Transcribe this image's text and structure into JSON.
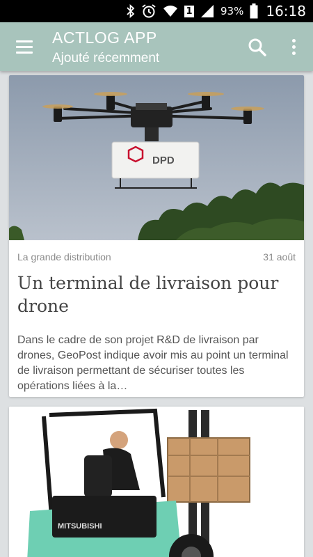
{
  "status_bar": {
    "battery": "93%",
    "sim_slot": "1",
    "time": "16:18"
  },
  "app_bar": {
    "title": "ACTLOG APP",
    "subtitle": "Ajouté récemment",
    "icons": [
      "menu-icon",
      "search-icon",
      "more-vert-icon"
    ],
    "color": "#a8c4bc"
  },
  "articles": [
    {
      "category": "La grande distribution",
      "date": "31 août",
      "title": "Un terminal de livraison pour drone",
      "excerpt": "Dans le cadre de son projet R&D de livraison par drones, GeoPost indique avoir mis au point un terminal de livraison permettant de sécuriser toutes les opérations liées à la…",
      "image_label": "DPD"
    },
    {
      "image_label": "MITSUBISHI"
    }
  ]
}
